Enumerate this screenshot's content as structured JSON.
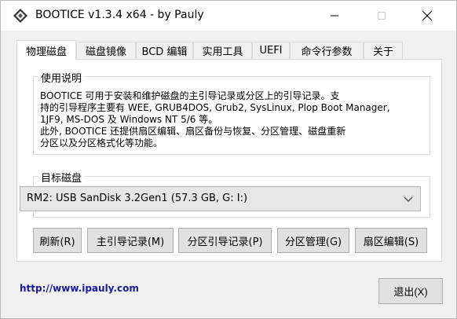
{
  "window": {
    "title": "BOOTICE v1.3.4 x64 - by Pauly",
    "icon": "bootice-app-icon"
  },
  "tabs": [
    {
      "label": "物理磁盘",
      "active": true
    },
    {
      "label": "磁盘镜像",
      "active": false
    },
    {
      "label": "BCD 编辑",
      "active": false
    },
    {
      "label": "实用工具",
      "active": false
    },
    {
      "label": "UEFI",
      "active": false
    },
    {
      "label": "命令行参数",
      "active": false
    },
    {
      "label": "关于",
      "active": false
    }
  ],
  "usage": {
    "title": "使用说明",
    "line1": "BOOTICE 可用于安装和维护磁盘的主引导记录或分区上的引导记录。支",
    "line2": "持的引导程序主要有 WEE, GRUB4DOS, Grub2, SysLinux, Plop Boot Manager,",
    "line3": "1JF9, MS-DOS 及 Windows NT 5/6 等。",
    "line4": "此外, BOOTICE 还提供扇区编辑、扇区备份与恢复、分区管理、磁盘重新",
    "line5": "分区以及分区格式化等功能。"
  },
  "target_disk": {
    "title": "目标磁盘",
    "selected": "RM2:  USB SanDisk 3.2Gen1 (57.3 GB, G: I:)"
  },
  "buttons": {
    "refresh": "刷新(R)",
    "mbr": "主引导记录(M)",
    "pbr": "分区引导记录(P)",
    "parts": "分区管理(G)",
    "sector": "扇区编辑(S)"
  },
  "footer": {
    "link": "http://www.ipauly.com",
    "exit": "退出(X)"
  }
}
